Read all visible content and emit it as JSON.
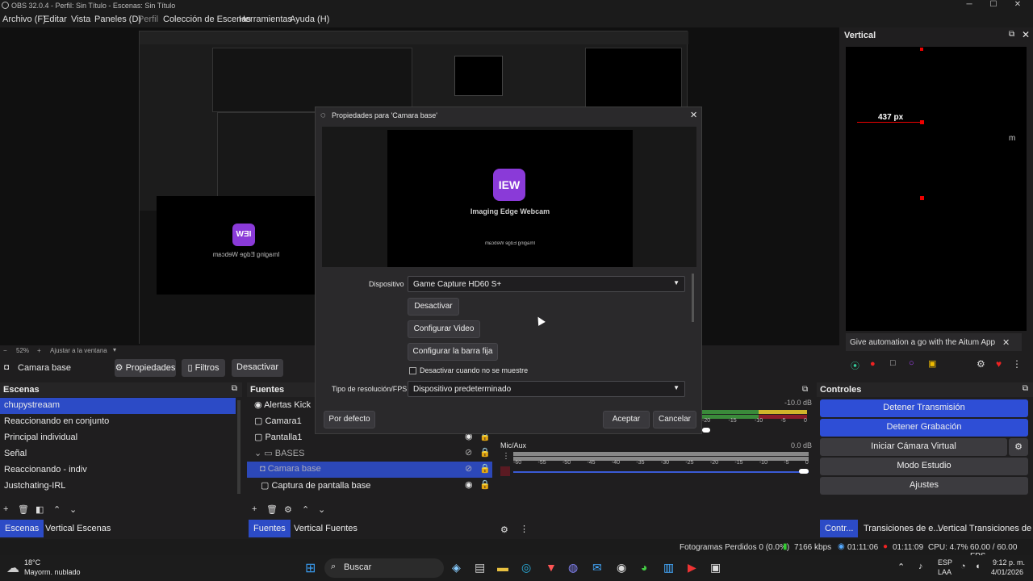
{
  "window": {
    "title": "OBS 32.0.4 - Perfil: Sin Título - Escenas: Sin Título"
  },
  "menu": [
    "Archivo (F)",
    "Editar",
    "Vista",
    "Paneles (D)",
    "Perfil",
    "Colección de Escenas",
    "Herramientas",
    "Ayuda (H)"
  ],
  "preview": {
    "zoom": "52%",
    "fit_label": "Ajustar a la ventana"
  },
  "vertical_dock": {
    "title": "Vertical",
    "measure": "437 px",
    "promo": "Give automation a go with the Aitum App",
    "side_label": "m"
  },
  "source_toolbar": {
    "source_name": "Camara base",
    "properties": "Propiedades",
    "filters": "Filtros",
    "deactivate": "Desactivar"
  },
  "webcam": {
    "logo": "IEW",
    "name": "Imaging Edge Webcam",
    "mirror_text": "Imaging Edge Webcam"
  },
  "modal": {
    "title": "Propiedades para 'Camara base'",
    "device_label": "Dispositivo",
    "device_value": "Game Capture HD60 S+",
    "btn_deactivate": "Desactivar",
    "btn_config_video": "Configurar Video",
    "btn_config_bar": "Configurar la barra fija",
    "checkbox_label": "Desactivar cuando no se muestre",
    "res_label": "Tipo de resolución/FPS",
    "res_value": "Dispositivo predeterminado",
    "default_btn": "Por defecto",
    "accept_btn": "Aceptar",
    "cancel_btn": "Cancelar"
  },
  "scenes": {
    "title": "Escenas",
    "items": [
      "chupystreaam",
      "Reaccionando en conjunto",
      "Principal individual",
      "Señal",
      "Reaccionando - indiv",
      "Justchating-IRL"
    ],
    "tabs": [
      "Escenas",
      "Vertical Escenas"
    ]
  },
  "sources": {
    "title": "Fuentes",
    "items": [
      "Alertas Kick",
      "Camara1",
      "Pantalla1",
      "BASES",
      "Camara base",
      "Captura de pantalla base"
    ],
    "tabs": [
      "Fuentes",
      "Vertical Fuentes"
    ]
  },
  "audio": {
    "ch1_db": "-10.0 dB",
    "ch2_name": "Mic/Aux",
    "ch2_db": "0.0 dB",
    "ticks": [
      "-60",
      "-55",
      "-50",
      "-45",
      "-40",
      "-35",
      "-30",
      "-25",
      "-20",
      "-15",
      "-10",
      "-5",
      "0"
    ],
    "ch1_ticks": [
      "-20",
      "-15",
      "-10",
      "-5",
      "0"
    ]
  },
  "controls": {
    "title": "Controles",
    "buttons": [
      "Detener Transmisión",
      "Detener Grabación",
      "Iniciar Cámara Virtual",
      "Modo Estudio",
      "Ajustes"
    ],
    "tabs": [
      "Contr...",
      "Transiciones de e...",
      "Vertical Transiciones de e..."
    ]
  },
  "status": {
    "dropped": "Fotogramas Perdidos 0 (0.0%)",
    "bitrate": "7166 kbps",
    "stream_time": "01:11:06",
    "rec_time": "01:11:09",
    "cpu": "CPU: 4.7%",
    "fps": "60.00 / 60.00 FPS"
  },
  "taskbar": {
    "temp": "18°C",
    "weather": "Mayorm. nublado",
    "search": "Buscar",
    "lang1": "ESP",
    "lang2": "LAA",
    "time": "9:12 p. m.",
    "date": "4/01/2026"
  },
  "colors": {
    "accent": "#2c4bc6",
    "rec": "#e11d1d",
    "logo": "#8a3ad8"
  }
}
